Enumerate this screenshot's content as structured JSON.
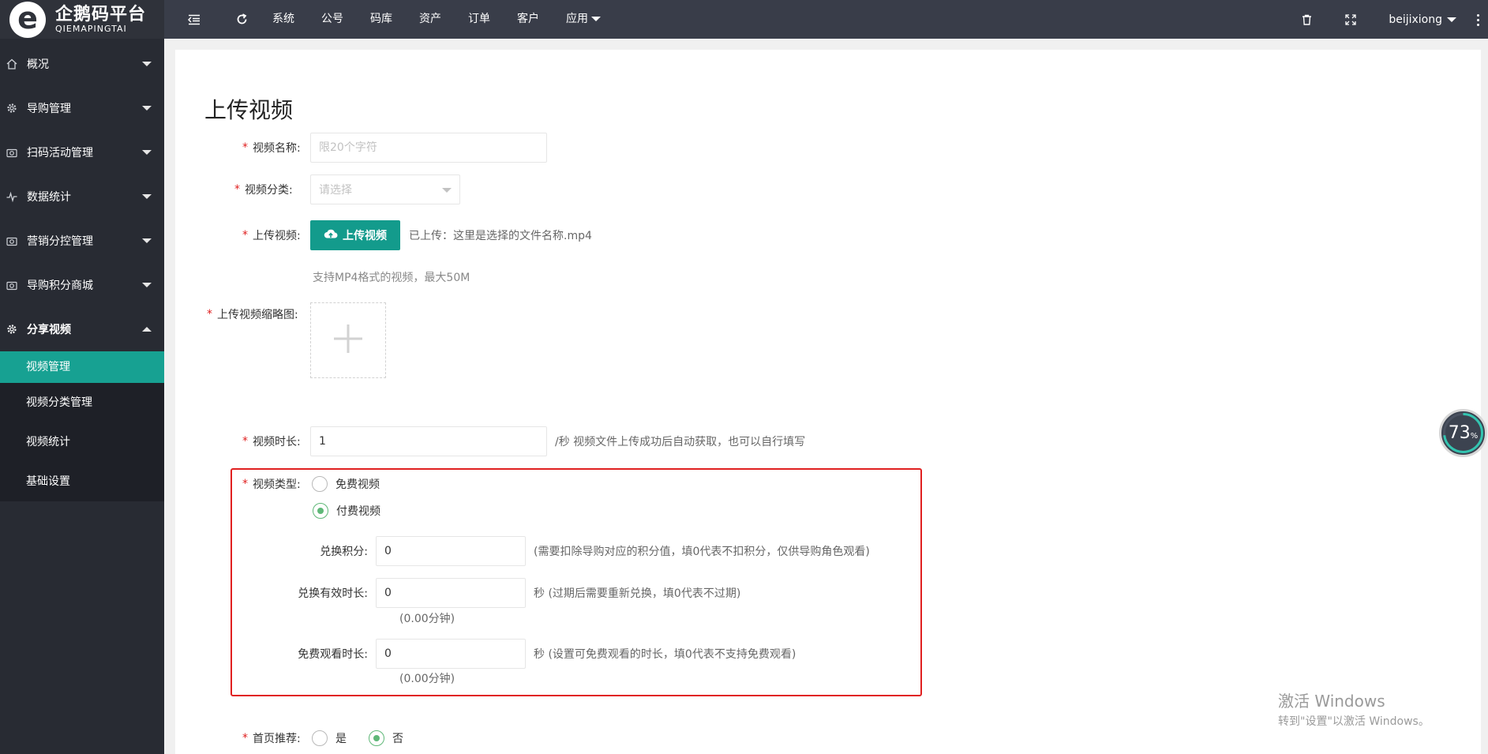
{
  "logo": {
    "cn": "企鹅码平台",
    "en": "QIEMAPINGTAI"
  },
  "topnav": {
    "items": [
      "系统",
      "公号",
      "码库",
      "资产",
      "订单",
      "客户"
    ],
    "app_label": "应用",
    "user": "beijixiong"
  },
  "sidebar": {
    "groups": [
      {
        "label": "概况",
        "icon": "home-icon"
      },
      {
        "label": "导购管理",
        "icon": "gear-icon"
      },
      {
        "label": "扫码活动管理",
        "icon": "camera-icon"
      },
      {
        "label": "数据统计",
        "icon": "pulse-icon"
      },
      {
        "label": "营销分控管理",
        "icon": "camera-icon"
      },
      {
        "label": "导购积分商城",
        "icon": "camera-icon"
      },
      {
        "label": "分享视频",
        "icon": "gear-icon"
      }
    ],
    "submenu": [
      "视频管理",
      "视频分类管理",
      "视频统计",
      "基础设置"
    ]
  },
  "page": {
    "title": "上传视频",
    "video_name": {
      "label": "视频名称:",
      "placeholder": "限20个字符"
    },
    "video_category": {
      "label": "视频分类:",
      "placeholder": "请选择"
    },
    "upload_video": {
      "label": "上传视频:",
      "button": "上传视频",
      "uploaded": "已上传：这里是选择的文件名称.mp4",
      "hint": "支持MP4格式的视频，最大50M"
    },
    "thumbnail": {
      "label": "上传视频缩略图:"
    },
    "duration": {
      "label": "视频时长:",
      "value": "1",
      "hint": "/秒 视频文件上传成功后自动获取，也可以自行填写"
    },
    "video_type": {
      "label": "视频类型:",
      "options": [
        "免费视频",
        "付费视频"
      ],
      "selected": "付费视频"
    },
    "exchange_points": {
      "label": "兑换积分:",
      "value": "0",
      "hint": "(需要扣除导购对应的积分值，填0代表不扣积分，仅供导购角色观看)"
    },
    "exchange_valid": {
      "label": "兑换有效时长:",
      "value": "0",
      "hint": "秒 (过期后需要重新兑换，填0代表不过期)",
      "sub": "(0.00分钟)"
    },
    "free_watch": {
      "label": "免费观看时长:",
      "value": "0",
      "hint": "秒 (设置可免费观看的时长，填0代表不支持免费观看)",
      "sub": "(0.00分钟)"
    },
    "homepage_recommend": {
      "label": "首页推荐:",
      "options": [
        "是",
        "否"
      ],
      "selected": "否"
    }
  },
  "progress_widget": {
    "value": "73",
    "unit": "%"
  },
  "watermark": {
    "title": "激活 Windows",
    "subtitle": "转到\"设置\"以激活 Windows。"
  },
  "colors": {
    "accent": "#139b8c",
    "sidebar_bg": "#282b33",
    "topbar_bg": "#393d49",
    "highlight": "#e02020",
    "radio_checked": "#5fb878"
  }
}
